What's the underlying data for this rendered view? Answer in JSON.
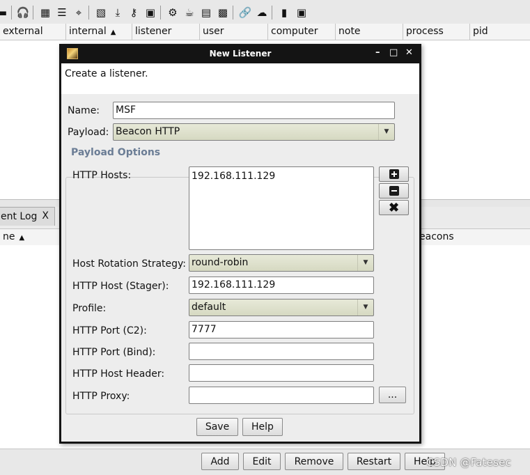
{
  "table_columns": [
    {
      "label": "external"
    },
    {
      "label": "internal",
      "sort": "▲"
    },
    {
      "label": "listener"
    },
    {
      "label": "user"
    },
    {
      "label": "computer"
    },
    {
      "label": "note"
    },
    {
      "label": "process"
    },
    {
      "label": "pid"
    }
  ],
  "event_tab": {
    "label": "ent Log",
    "close": "X"
  },
  "table2_columns": [
    {
      "label": "ne",
      "sort": "▲"
    },
    {
      "label": "eacons"
    }
  ],
  "bottom_buttons": {
    "add": "Add",
    "edit": "Edit",
    "remove": "Remove",
    "restart": "Restart",
    "help": "Help"
  },
  "watermark": "CSDN @Fatesec",
  "toolbar_icons": [
    "minus-icon",
    "headphones-icon",
    "graph-icon",
    "list-icon",
    "target-icon",
    "image-icon",
    "download-icon",
    "key-icon",
    "picture-icon",
    "gear-icon",
    "coffee-icon",
    "document-icon",
    "terminal-icon",
    "link-icon",
    "cloud-icon",
    "book-icon",
    "cube-icon"
  ],
  "dialog": {
    "title": "New Listener",
    "controls": {
      "minimize": "–",
      "maximize": "□",
      "close": "✕"
    },
    "description": "Create a listener.",
    "name_label": "Name:",
    "name_value": "MSF",
    "payload_label": "Payload:",
    "payload_value": "Beacon HTTP",
    "group_title": "Payload Options",
    "http_hosts_label": "HTTP Hosts:",
    "http_hosts": [
      "192.168.111.129"
    ],
    "host_rotation_label": "Host Rotation Strategy:",
    "host_rotation_value": "round-robin",
    "stager_host_label": "HTTP Host (Stager):",
    "stager_host_value": "192.168.111.129",
    "profile_label": "Profile:",
    "profile_value": "default",
    "port_c2_label": "HTTP Port (C2):",
    "port_c2_value": "7777",
    "port_bind_label": "HTTP Port (Bind):",
    "port_bind_value": "",
    "host_header_label": "HTTP Host Header:",
    "host_header_value": "",
    "proxy_label": "HTTP Proxy:",
    "proxy_value": "",
    "proxy_button": "...",
    "save_button": "Save",
    "help_button": "Help"
  }
}
